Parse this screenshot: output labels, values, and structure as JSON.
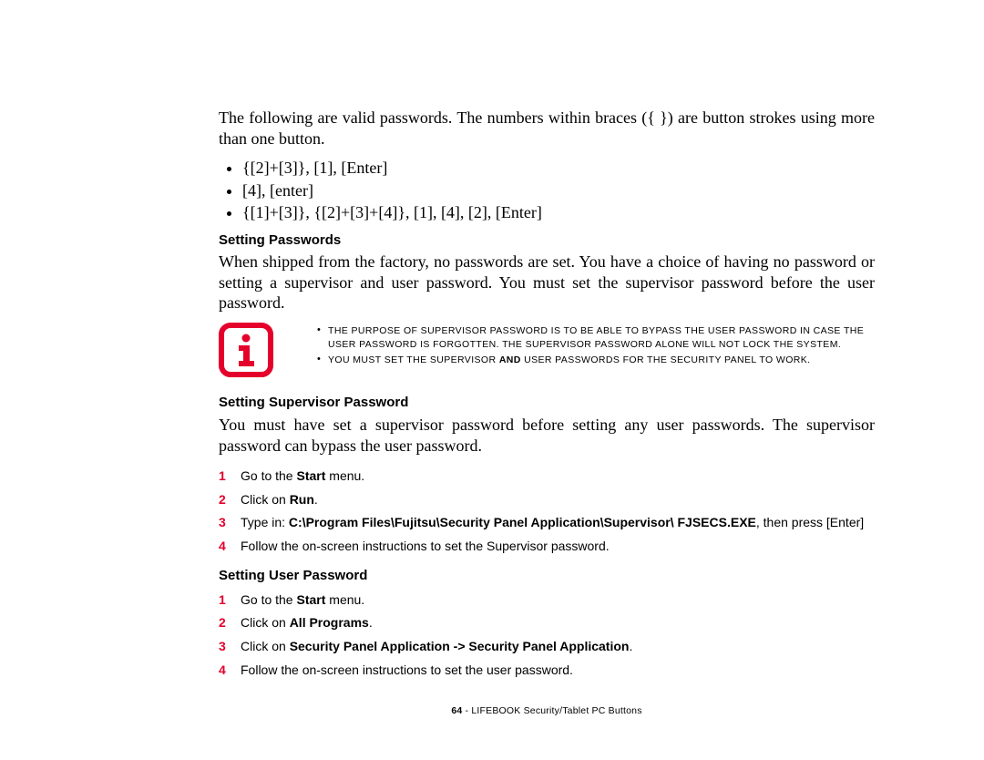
{
  "intro": "The following are valid passwords. The numbers within braces ({  }) are button strokes using more than one button.",
  "pw_examples": [
    "{[2]+[3]}, [1], [Enter]",
    "[4], [enter]",
    "{[1]+[3]}, {[2]+[3]+[4]}, [1], [4], [2], [Enter]"
  ],
  "headings": {
    "setting_passwords": "Setting Passwords",
    "setting_supervisor": "Setting Supervisor Password",
    "setting_user": "Setting User Password"
  },
  "setting_passwords_para": "When shipped from the factory, no passwords are set. You have a choice of having no password or setting a supervisor and user password. You must set the supervisor password before the user password.",
  "info": {
    "note1": "The purpose of supervisor password is to be able to bypass the user password in case the user password is forgotten. The supervisor password alone will not lock the system.",
    "note2_a": "You must set the supervisor ",
    "note2_bold": "and",
    "note2_b": " user passwords for the security panel to work."
  },
  "supervisor_intro": "You must have set a supervisor password before setting any user passwords. The supervisor password can bypass the user password.",
  "steps_supervisor": [
    {
      "n": "1",
      "pre": "Go to the ",
      "bold": "Start",
      "post": " menu."
    },
    {
      "n": "2",
      "pre": "Click on ",
      "bold": "Run",
      "post": "."
    },
    {
      "n": "3",
      "pre": "Type in: ",
      "bold": "C:\\Program Files\\Fujitsu\\Security Panel Application\\Supervisor\\ FJSECS.EXE",
      "post": ", then press [Enter]"
    },
    {
      "n": "4",
      "pre": "Follow the on-screen instructions to set the Supervisor password.",
      "bold": "",
      "post": ""
    }
  ],
  "steps_user": [
    {
      "n": "1",
      "pre": "Go to the ",
      "bold": "Start",
      "post": " menu."
    },
    {
      "n": "2",
      "pre": "Click on ",
      "bold": "All Programs",
      "post": "."
    },
    {
      "n": "3",
      "pre": "Click on ",
      "bold": "Security Panel Application -> Security Panel Application",
      "post": "."
    },
    {
      "n": "4",
      "pre": "Follow the on-screen instructions to set the user password.",
      "bold": "",
      "post": ""
    }
  ],
  "footer": {
    "page": "64",
    "sep": " - ",
    "title": "LIFEBOOK Security/Tablet PC Buttons"
  }
}
